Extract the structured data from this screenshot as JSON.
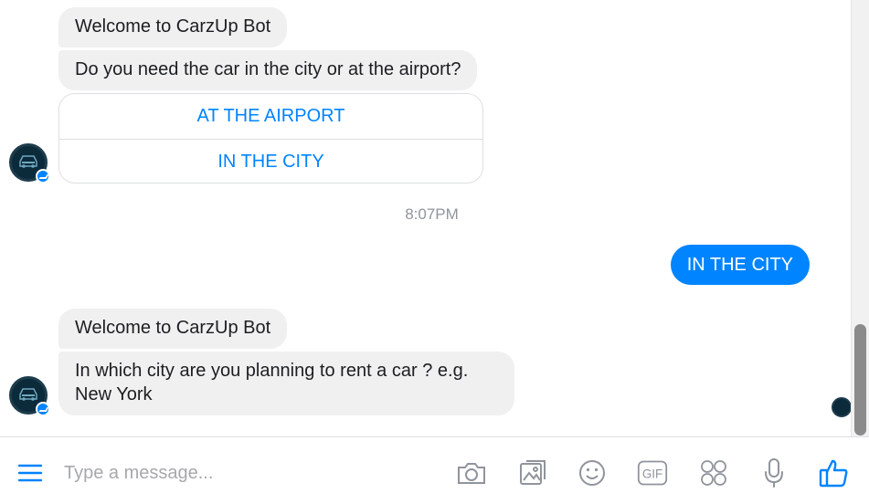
{
  "conversation": {
    "messages": [
      {
        "from": "bot",
        "text": "Welcome to CarzUp Bot"
      },
      {
        "from": "bot",
        "text": "Do you need the car in the city or at the airport?"
      },
      {
        "from": "bot",
        "text": "Welcome to CarzUp Bot"
      },
      {
        "from": "bot",
        "text": "In which city are you planning to rent a car ? e.g. New York"
      }
    ],
    "quick_replies": [
      "AT THE AIRPORT",
      "IN THE CITY"
    ],
    "timestamp": "8:07PM",
    "user_reply": "IN THE CITY"
  },
  "composer": {
    "placeholder": "Type a message..."
  },
  "colors": {
    "accent": "#0084ff",
    "bot_bubble": "#f0f0f0",
    "avatar_bg": "#0b2a3a"
  },
  "icons": [
    "menu-icon",
    "camera-icon",
    "image-icon",
    "emoji-icon",
    "gif-icon",
    "stickers-icon",
    "microphone-icon",
    "thumbs-up-icon"
  ]
}
